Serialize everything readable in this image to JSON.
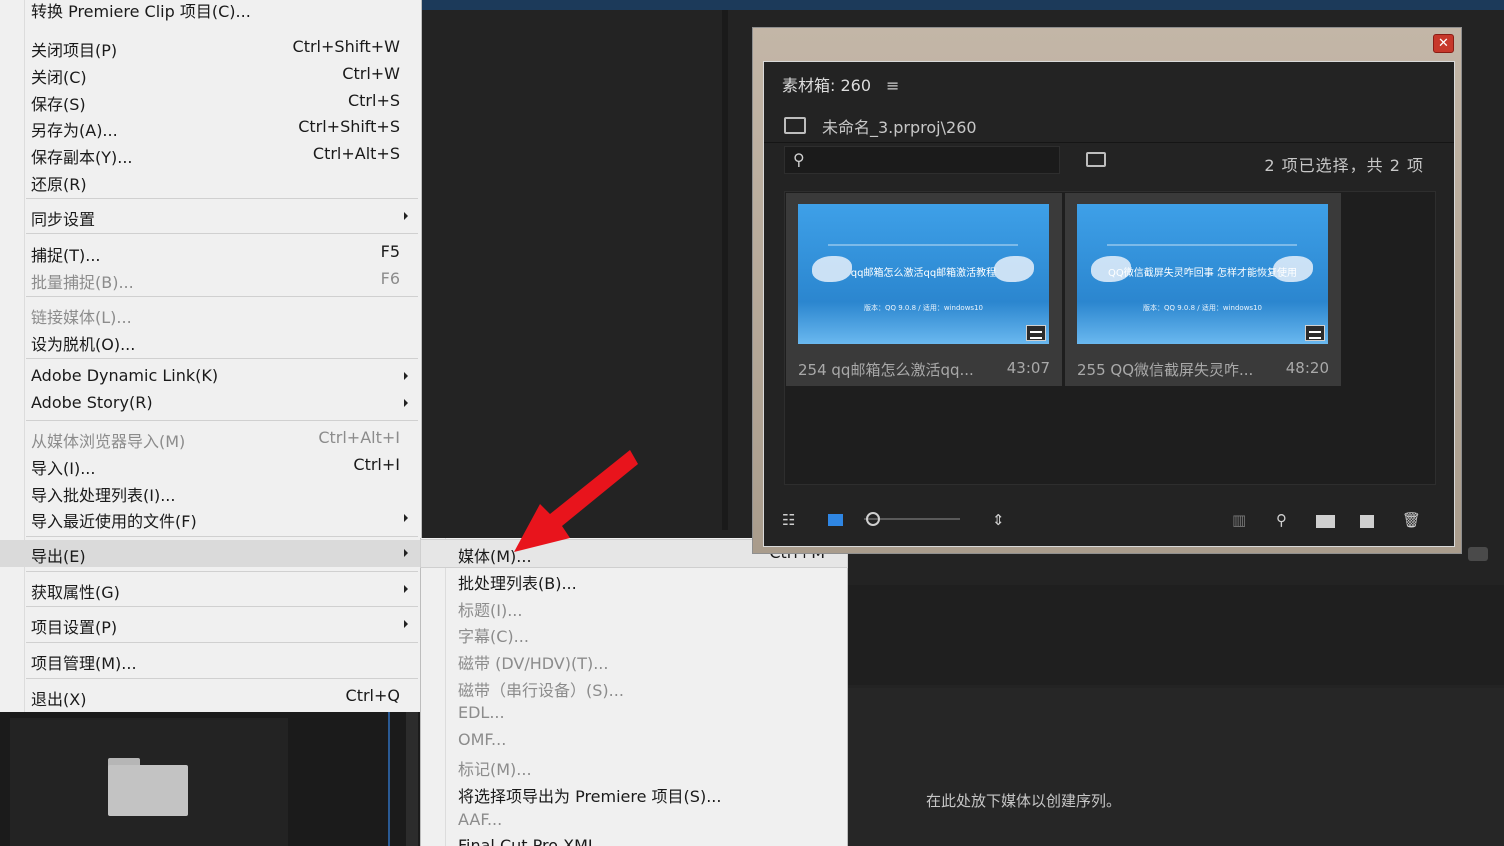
{
  "file_menu": {
    "partial_top_label": "转换 Premiere Clip 项目(C)...",
    "groups": [
      [
        {
          "label": "关闭项目(P)",
          "shortcut": "Ctrl+Shift+W"
        },
        {
          "label": "关闭(C)",
          "shortcut": "Ctrl+W"
        },
        {
          "label": "保存(S)",
          "shortcut": "Ctrl+S"
        },
        {
          "label": "另存为(A)...",
          "shortcut": "Ctrl+Shift+S"
        },
        {
          "label": "保存副本(Y)...",
          "shortcut": "Ctrl+Alt+S"
        },
        {
          "label": "还原(R)",
          "shortcut": ""
        }
      ],
      [
        {
          "label": "同步设置",
          "shortcut": ""
        }
      ],
      [
        {
          "label": "捕捉(T)...",
          "shortcut": "F5"
        },
        {
          "label": "批量捕捉(B)...",
          "shortcut": "F6"
        }
      ],
      [
        {
          "label": "链接媒体(L)...",
          "shortcut": ""
        },
        {
          "label": "设为脱机(O)...",
          "shortcut": ""
        }
      ],
      [
        {
          "label": "Adobe Dynamic Link(K)",
          "shortcut": ""
        },
        {
          "label": "Adobe Story(R)",
          "shortcut": ""
        }
      ],
      [
        {
          "label": "从媒体浏览器导入(M)",
          "shortcut": "Ctrl+Alt+I"
        },
        {
          "label": "导入(I)...",
          "shortcut": "Ctrl+I"
        },
        {
          "label": "导入批处理列表(I)...",
          "shortcut": ""
        },
        {
          "label": "导入最近使用的文件(F)",
          "shortcut": ""
        }
      ],
      [
        {
          "label": "导出(E)",
          "shortcut": ""
        }
      ],
      [
        {
          "label": "获取属性(G)",
          "shortcut": ""
        }
      ],
      [
        {
          "label": "项目设置(P)",
          "shortcut": ""
        }
      ],
      [
        {
          "label": "项目管理(M)...",
          "shortcut": ""
        }
      ],
      [
        {
          "label": "退出(X)",
          "shortcut": "Ctrl+Q"
        }
      ]
    ]
  },
  "export_submenu": {
    "items": [
      {
        "label": "媒体(M)...",
        "shortcut": "Ctrl+M"
      },
      {
        "label": "批处理列表(B)...",
        "shortcut": ""
      },
      {
        "label": "标题(I)...",
        "shortcut": ""
      },
      {
        "label": "字幕(C)...",
        "shortcut": ""
      },
      {
        "label": "磁带 (DV/HDV)(T)...",
        "shortcut": ""
      },
      {
        "label": "磁带（串行设备）(S)...",
        "shortcut": ""
      },
      {
        "label": "EDL...",
        "shortcut": ""
      },
      {
        "label": "OMF...",
        "shortcut": ""
      },
      {
        "label": "标记(M)...",
        "shortcut": ""
      },
      {
        "label": "将选择项导出为 Premiere 项目(S)...",
        "shortcut": ""
      },
      {
        "label": "AAF...",
        "shortcut": ""
      },
      {
        "label": "Final Cut Pro XML...",
        "shortcut": ""
      }
    ]
  },
  "bin": {
    "title": "素材箱: 260",
    "close_glyph": "✕",
    "path": "未命名_3.prproj\\260",
    "search_placeholder": "",
    "selection_status": "2 项已选择，共 2 项",
    "clips": [
      {
        "name": "254  qq邮箱怎么激活qq...",
        "duration": "43:07",
        "thumb_title": "qq邮箱怎么激活qq邮箱激活教程",
        "thumb_sub": "版本：QQ 9.0.8 / 适用：windows10"
      },
      {
        "name": "255 QQ微信截屏失灵咋...",
        "duration": "48:20",
        "thumb_title": "QQ微信截屏失灵咋回事 怎样才能恢复使用",
        "thumb_sub": "版本：QQ 9.0.8 / 适用：windows10"
      }
    ],
    "toolbar_icons": [
      "list-view-icon",
      "icon-view-icon",
      "zoom-slider",
      "sort-icon",
      "automate-icon",
      "find-icon",
      "new-bin-icon",
      "new-item-icon",
      "trash-icon"
    ]
  },
  "sequence_panel": {
    "drop_hint": "在此处放下媒体以创建序列。"
  },
  "colors": {
    "menu_bg": "#f0f0f0",
    "menu_disabled": "#8c8c8c",
    "highlight_arrow": "#e8141c",
    "thumb_blue": "#2b86cf"
  }
}
